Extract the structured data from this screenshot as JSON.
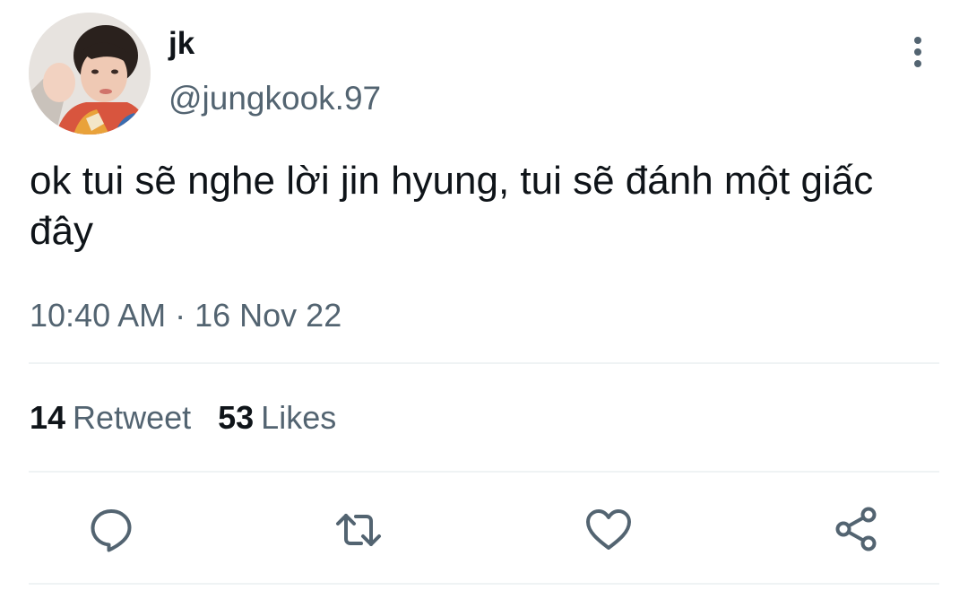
{
  "user": {
    "display_name": "jk",
    "handle": "@jungkook.97"
  },
  "tweet": {
    "text": "ok tui sẽ nghe lời jin hyung, tui sẽ đánh một giấc đây",
    "time": "10:40 AM",
    "separator": "·",
    "date": "16 Nov 22"
  },
  "stats": {
    "retweets_count": "14",
    "retweets_label": "Retweet",
    "likes_count": "53",
    "likes_label": "Likes"
  },
  "icons": {
    "more": "more-vertical-icon",
    "reply": "reply-icon",
    "retweet": "retweet-icon",
    "like": "heart-icon",
    "share": "share-icon"
  },
  "colors": {
    "text_primary": "#0f1419",
    "text_secondary": "#536471",
    "divider": "#eff3f4"
  }
}
